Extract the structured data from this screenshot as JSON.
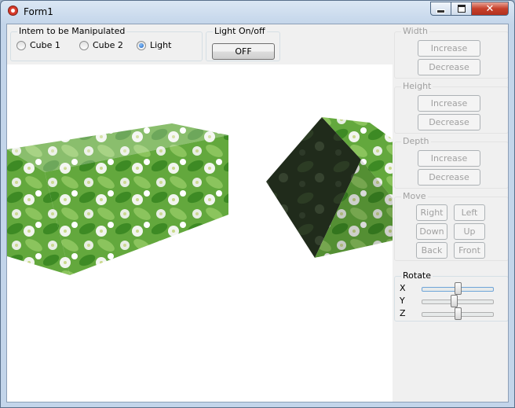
{
  "window": {
    "title": "Form1",
    "close_glyph": "✕",
    "icon": "app-icon"
  },
  "manipulate": {
    "title": "Intem to be Manipulated",
    "options": [
      {
        "label": "Cube 1",
        "checked": false
      },
      {
        "label": "Cube 2",
        "checked": false
      },
      {
        "label": "Light",
        "checked": true
      }
    ]
  },
  "light": {
    "title": "Light On/off",
    "button_label": "OFF"
  },
  "width": {
    "title": "Width",
    "increase": "Increase",
    "decrease": "Decrease"
  },
  "height": {
    "title": "Height",
    "increase": "Increase",
    "decrease": "Decrease"
  },
  "depth": {
    "title": "Depth",
    "increase": "Increase",
    "decrease": "Decrease"
  },
  "move": {
    "title": "Move",
    "right": "Right",
    "left": "Left",
    "down": "Down",
    "up": "Up",
    "back": "Back",
    "front": "Front"
  },
  "rotate": {
    "title": "Rotate",
    "sliders": [
      {
        "axis": "X",
        "value": 0.5
      },
      {
        "axis": "Y",
        "value": 0.45
      },
      {
        "axis": "Z",
        "value": 0.5
      }
    ]
  },
  "colors": {
    "leaf_green": "#4d9c2c",
    "blossom": "#eef3e8",
    "dark_face": "#1f2a1a"
  }
}
